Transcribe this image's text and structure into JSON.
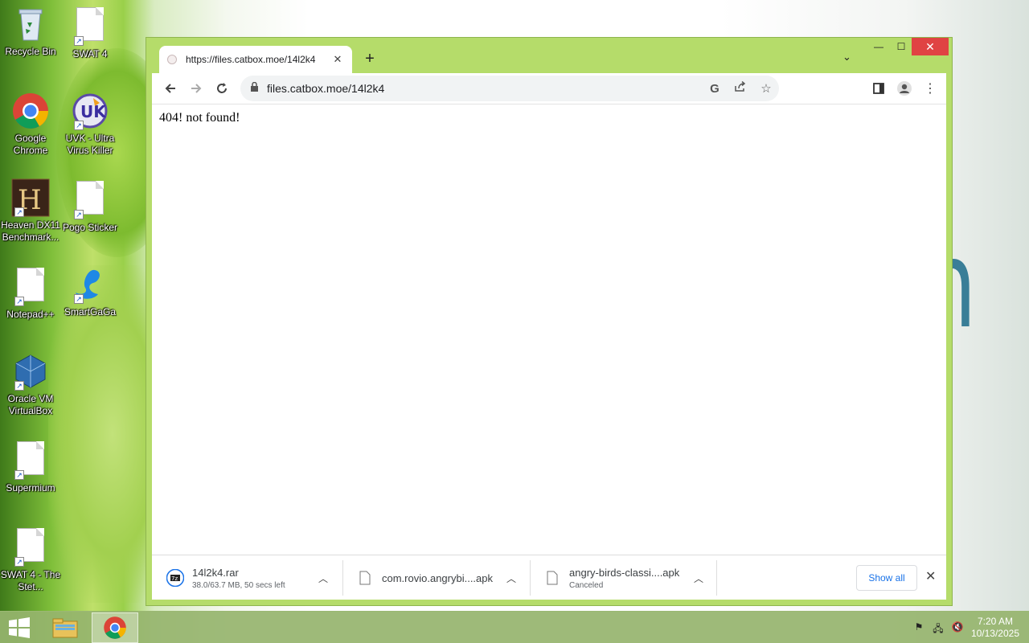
{
  "desktop": {
    "icons": [
      {
        "label": "Recycle Bin"
      },
      {
        "label": "SWAT 4"
      },
      {
        "label": "Google Chrome"
      },
      {
        "label": "UVK - Ultra Virus Killer"
      },
      {
        "label": "Heaven DX11 Benchmark..."
      },
      {
        "label": "Pogo Sticker"
      },
      {
        "label": "Notepad++"
      },
      {
        "label": "SmartGaGa"
      },
      {
        "label": "Oracle VM VirtualBox"
      },
      {
        "label": "Supermium"
      },
      {
        "label": "SWAT 4 - The Stet..."
      }
    ]
  },
  "browser": {
    "tab": {
      "title": "https://files.catbox.moe/14l2k4",
      "close": "✕"
    },
    "new_tab": "+",
    "tab_menu": "⌄",
    "window_controls": {
      "minimize": "—",
      "maximize": "☐",
      "close": "✕"
    },
    "omnibox": {
      "url": "files.catbox.moe/14l2k4"
    },
    "page": {
      "message": "404! not found!"
    },
    "downloads": [
      {
        "name": "14l2k4.rar",
        "status": "38.0/63.7 MB, 50 secs left"
      },
      {
        "name": "com.rovio.angrybi....apk",
        "status": ""
      },
      {
        "name": "angry-birds-classi....apk",
        "status": "Canceled"
      }
    ],
    "show_all": "Show all"
  },
  "taskbar": {
    "clock_time": "7:20 AM",
    "clock_date": "10/13/2025"
  },
  "colors": {
    "window_frame": "#b5dc6a",
    "close_red": "#e04343",
    "link_blue": "#1a73e8"
  }
}
